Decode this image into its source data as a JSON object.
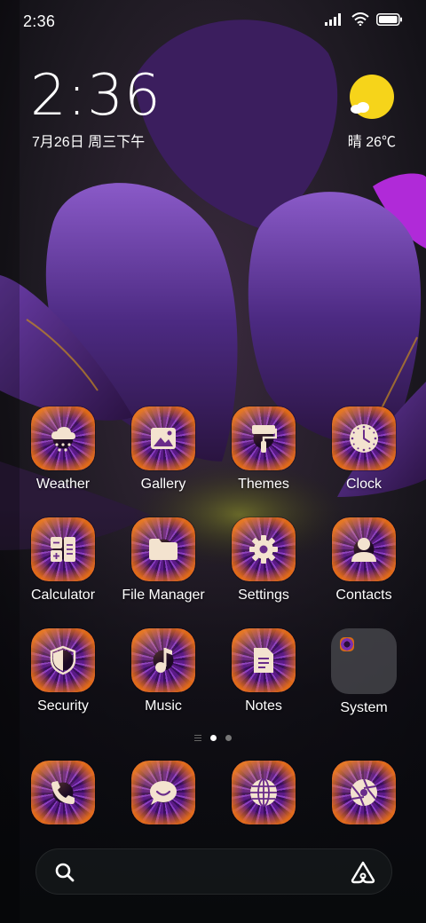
{
  "status_bar": {
    "time": "2:36",
    "signal_icon": "signal-icon",
    "wifi_icon": "wifi-icon",
    "battery_icon": "battery-icon"
  },
  "clock_widget": {
    "time": "2:36",
    "date": "7月26日 周三下午"
  },
  "weather_widget": {
    "condition_icon": "sunny-cloud-icon",
    "text": "晴 26℃",
    "sun_color": "#f6d41a"
  },
  "apps": [
    {
      "label": "Weather",
      "icon": "weather-snow-icon"
    },
    {
      "label": "Gallery",
      "icon": "image-icon"
    },
    {
      "label": "Themes",
      "icon": "paint-roller-icon"
    },
    {
      "label": "Clock",
      "icon": "clock-icon"
    },
    {
      "label": "Calculator",
      "icon": "calculator-icon"
    },
    {
      "label": "File Manager",
      "icon": "folder-icon"
    },
    {
      "label": "Settings",
      "icon": "gear-icon"
    },
    {
      "label": "Contacts",
      "icon": "person-icon"
    },
    {
      "label": "Security",
      "icon": "shield-icon"
    },
    {
      "label": "Music",
      "icon": "music-note-icon"
    },
    {
      "label": "Notes",
      "icon": "note-icon"
    },
    {
      "label": "System",
      "icon": "folder-group-icon"
    }
  ],
  "dock": [
    {
      "icon": "phone-icon"
    },
    {
      "icon": "message-icon"
    },
    {
      "icon": "globe-icon"
    },
    {
      "icon": "camera-aperture-icon"
    }
  ],
  "page_indicator": {
    "pages": 2,
    "current": 1
  },
  "search_bar": {
    "search_icon": "search-icon",
    "assistant_icon": "assistant-icon"
  },
  "theme": {
    "icon_fill_purple": "#5a1a86",
    "icon_rim_orange": "#e66e14",
    "petal_purple": "#4a2378"
  }
}
